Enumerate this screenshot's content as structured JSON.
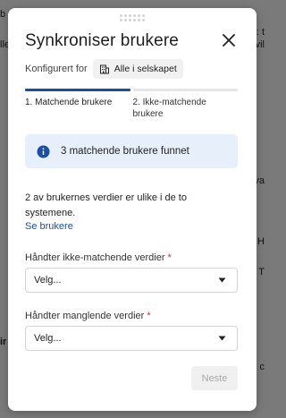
{
  "background": {
    "fragments_left": [
      "b",
      "lle",
      "",
      "",
      "",
      "",
      "",
      "",
      "",
      "",
      "",
      "",
      "",
      "",
      "",
      "ir",
      "",
      "",
      ""
    ],
    "fragments_right": [
      ": t",
      "vil",
      "",
      "",
      "",
      "",
      "",
      "",
      "",
      "sva",
      "",
      "",
      "H",
      "i T",
      "",
      "",
      "i c",
      "",
      ""
    ]
  },
  "modal": {
    "title": "Synkroniser brukere",
    "configured_label": "Konfigurert for",
    "scope_chip": "Alle i selskapet",
    "steps": [
      {
        "label": "1. Matchende brukere",
        "active": true
      },
      {
        "label": "2. Ikke-matchende brukere",
        "active": false
      }
    ],
    "info_text": "3 matchende brukere funnet",
    "description": "2 av brukernes verdier er ulike i de to systemene.",
    "link_text": "Se brukere",
    "field1": {
      "label": "Håndter ikke-matchende verdier",
      "required": "*",
      "value": "Velg..."
    },
    "field2": {
      "label": "Håndter manglende verdier",
      "required": "*",
      "value": "Velg..."
    },
    "next_label": "Neste"
  },
  "colors": {
    "accent": "#1a4fa8",
    "info_bg": "#e7effa",
    "required": "#c0392b"
  }
}
